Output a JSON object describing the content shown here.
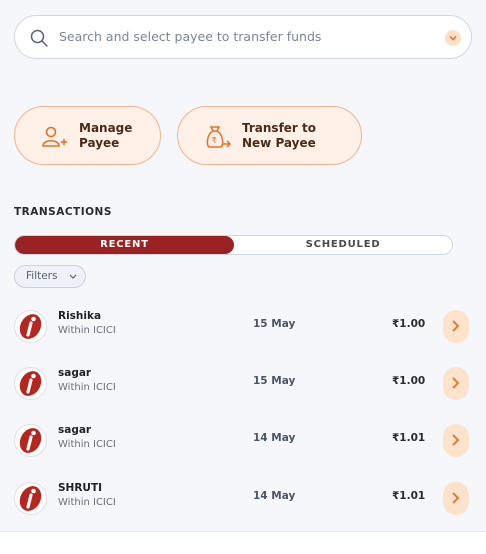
{
  "search": {
    "placeholder": "Search and select payee to transfer funds"
  },
  "actions": [
    {
      "label_line1": "Manage",
      "label_line2": "Payee",
      "icon": "add-user-icon"
    },
    {
      "label_line1": "Transfer to",
      "label_line2": "New Payee",
      "icon": "money-bag-transfer-icon"
    }
  ],
  "transactions": {
    "title": "TRANSACTIONS",
    "tabs": {
      "recent": "RECENT",
      "scheduled": "SCHEDULED",
      "active": "recent"
    },
    "filters_label": "Filters",
    "rows": [
      {
        "name": "Rishika",
        "bank": "Within ICICI",
        "date": "15 May",
        "amount": "₹1.00"
      },
      {
        "name": "sagar",
        "bank": "Within ICICI",
        "date": "15 May",
        "amount": "₹1.00"
      },
      {
        "name": "sagar",
        "bank": "Within ICICI",
        "date": "14 May",
        "amount": "₹1.01"
      },
      {
        "name": "SHRUTI",
        "bank": "Within ICICI",
        "date": "14 May",
        "amount": "₹1.01"
      }
    ]
  },
  "colors": {
    "accent": "#f28a3c",
    "recent_tab": "#9b2222",
    "logo_red": "#b5261e"
  }
}
